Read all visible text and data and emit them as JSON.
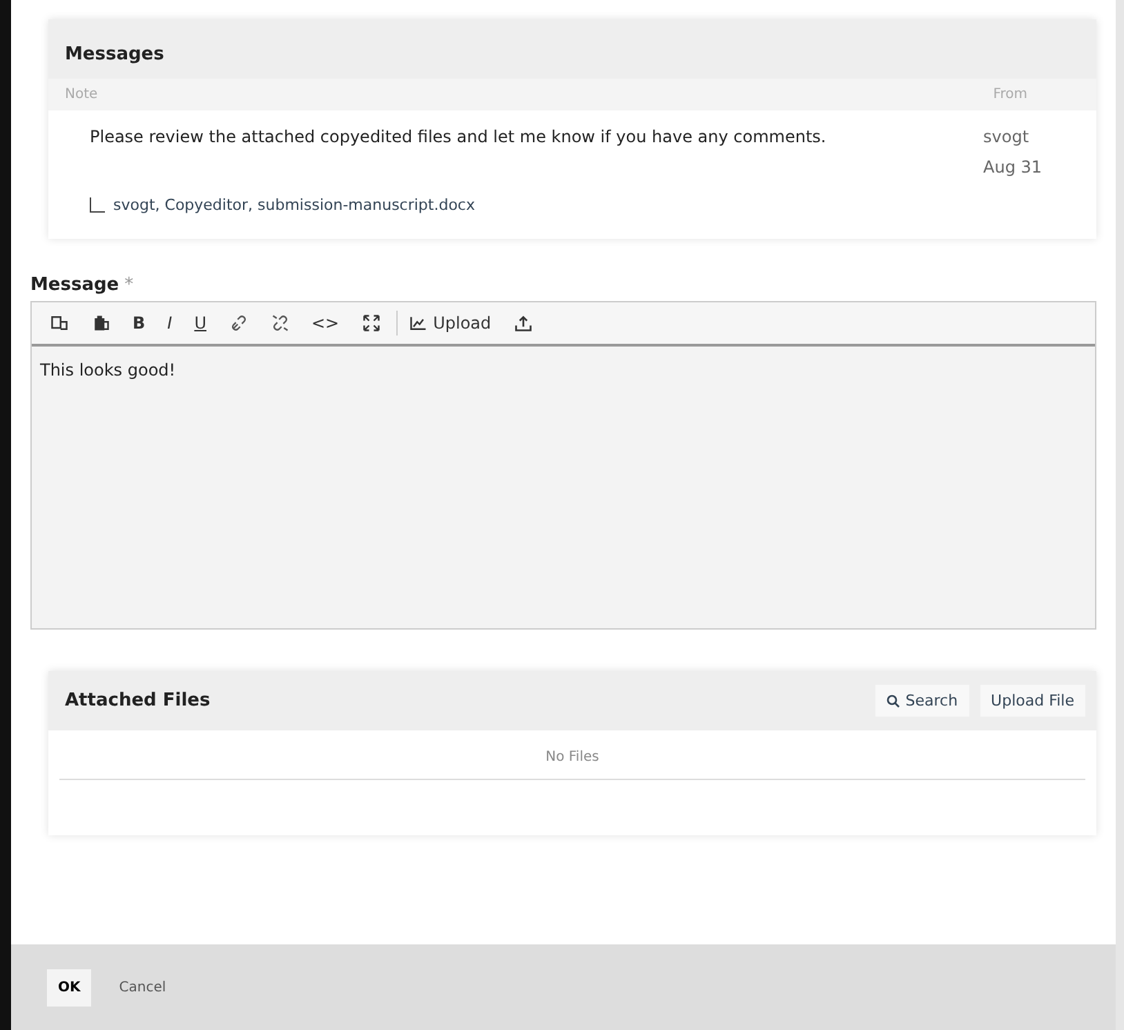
{
  "messages": {
    "title": "Messages",
    "columns": [
      "Note",
      "From"
    ],
    "rows": [
      {
        "note": "Please review the attached copyedited files and let me know if you have any comments.",
        "from": "svogt",
        "date": "Aug 31",
        "attachment": "svogt, Copyeditor, submission-manuscript.docx"
      }
    ]
  },
  "message_field": {
    "label": "Message",
    "required_mark": "*",
    "value": "This looks good!",
    "toolbar": [
      {
        "kind": "icon"
      },
      {
        "kind": "icon"
      },
      {
        "kind": "char",
        "text": "B"
      },
      {
        "kind": "char",
        "text": "I"
      },
      {
        "kind": "char",
        "text": "U"
      },
      {
        "kind": "icon"
      },
      {
        "kind": "icon"
      },
      {
        "kind": "char",
        "text": "<>"
      },
      {
        "kind": "icon"
      },
      {
        "kind": "image",
        "text": "Upload"
      },
      {
        "kind": "icon"
      }
    ]
  },
  "attached_files": {
    "title": "Attached Files",
    "buttons": [
      {
        "kind": "search",
        "label": "Search"
      },
      {
        "kind": "plain",
        "label": "Upload File"
      }
    ],
    "empty_text": "No Files"
  },
  "footer": {
    "buttons": [
      "OK",
      "Cancel"
    ]
  }
}
